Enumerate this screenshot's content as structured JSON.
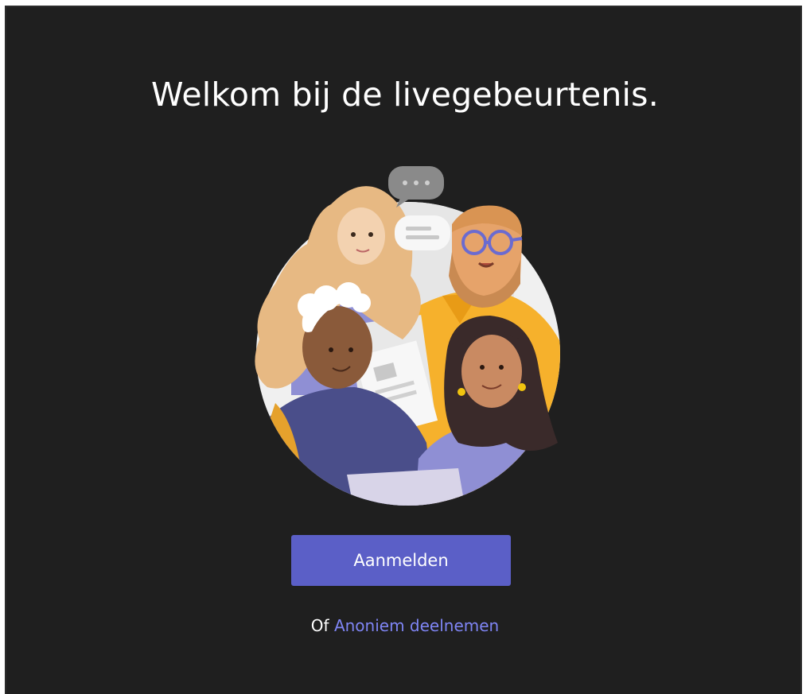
{
  "welcome": {
    "title": "Welkom bij de livegebeurtenis."
  },
  "actions": {
    "signin_label": "Aanmelden",
    "alt_prefix": "Of",
    "anonymous_label": "Anoniem deelnemen"
  },
  "illustration": {
    "icon": "people-collaboration-illustration"
  },
  "colors": {
    "background": "#1f1f1f",
    "primary_button": "#5b5fc7",
    "link": "#7f85f5",
    "text": "#ffffff"
  }
}
